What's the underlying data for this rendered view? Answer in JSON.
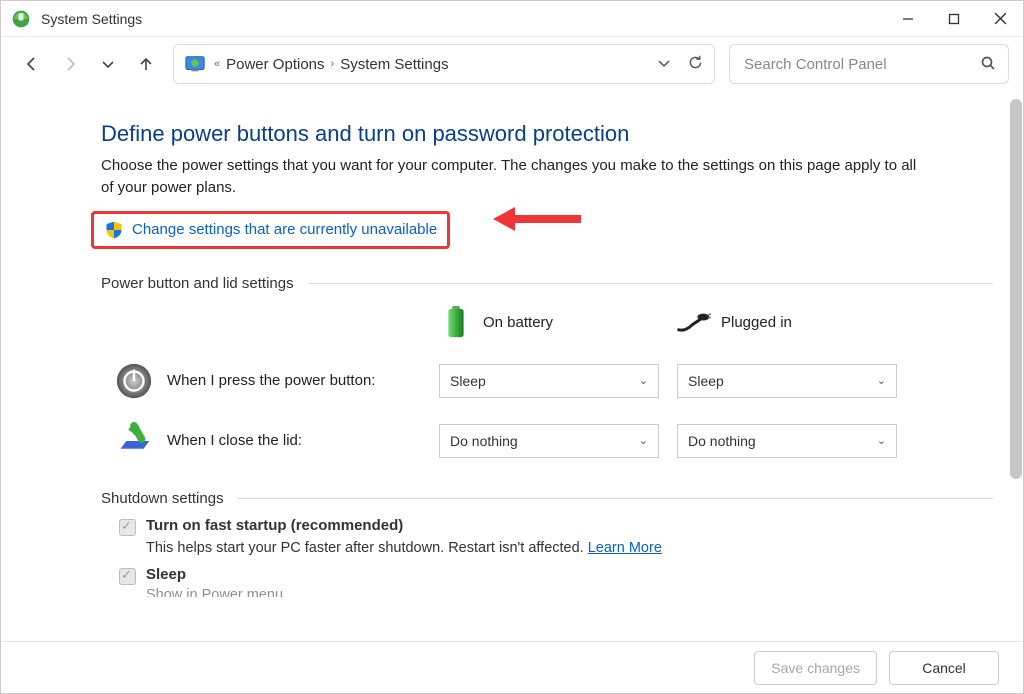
{
  "window": {
    "title": "System Settings"
  },
  "breadcrumbs": {
    "chev": "«",
    "item1": "Power Options",
    "sep": "›",
    "item2": "System Settings"
  },
  "search": {
    "placeholder": "Search Control Panel"
  },
  "page": {
    "title": "Define power buttons and turn on password protection",
    "desc": "Choose the power settings that you want for your computer. The changes you make to the settings on this page apply to all of your power plans.",
    "change_link": "Change settings that are currently unavailable"
  },
  "sections": {
    "power_lid": "Power button and lid settings",
    "shutdown": "Shutdown settings"
  },
  "columns": {
    "battery": "On battery",
    "plugged": "Plugged in"
  },
  "rows": {
    "power_button": {
      "label": "When I press the power button:",
      "battery": "Sleep",
      "plugged": "Sleep"
    },
    "close_lid": {
      "label": "When I close the lid:",
      "battery": "Do nothing",
      "plugged": "Do nothing"
    }
  },
  "shutdown": {
    "fast_startup": {
      "label": "Turn on fast startup (recommended)",
      "desc_pre": "This helps start your PC faster after shutdown. Restart isn't affected. ",
      "learn": "Learn More"
    },
    "sleep": {
      "label": "Sleep",
      "cut": "Show in Power menu"
    }
  },
  "footer": {
    "save": "Save changes",
    "cancel": "Cancel"
  }
}
